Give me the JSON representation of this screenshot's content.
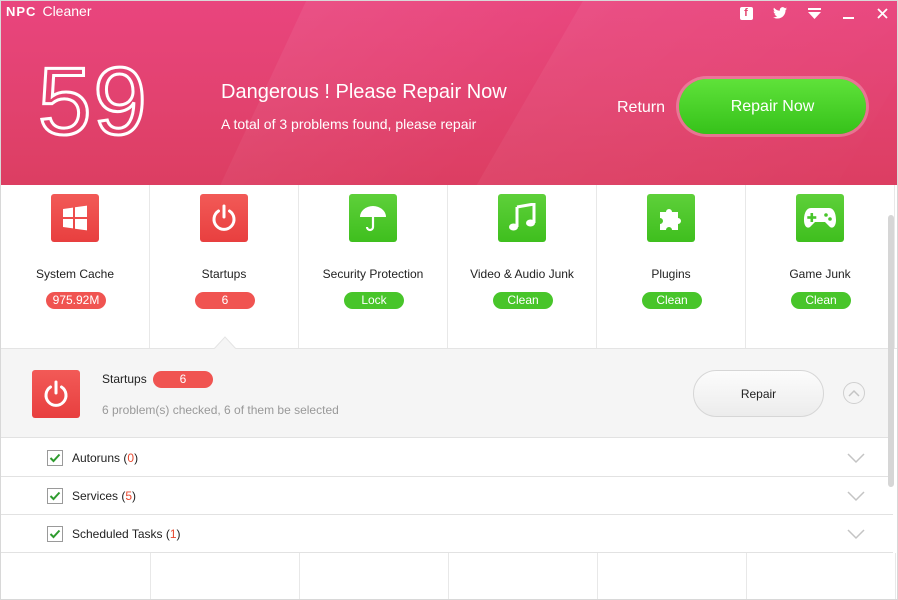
{
  "app": {
    "logo_mark": "NPC",
    "title": "Cleaner"
  },
  "window_controls": [
    {
      "name": "facebook-icon",
      "glyph": "f"
    },
    {
      "name": "twitter-icon",
      "glyph": "🐦"
    },
    {
      "name": "menu-icon",
      "glyph": "▼"
    },
    {
      "name": "minimize-icon",
      "glyph": "—"
    },
    {
      "name": "close-icon",
      "glyph": "✕"
    }
  ],
  "header": {
    "score": "59",
    "status_title": "Dangerous ! Please Repair Now",
    "status_subtitle": "A total of 3 problems found, please repair",
    "return_label": "Return",
    "repair_now_label": "Repair Now"
  },
  "categories": [
    {
      "name": "System Cache",
      "badge": "975.92M",
      "color": "red",
      "icon": "windows-icon"
    },
    {
      "name": "Startups",
      "badge": "6",
      "color": "red",
      "icon": "power-icon"
    },
    {
      "name": "Security Protection",
      "badge": "Lock",
      "color": "green",
      "icon": "umbrella-icon"
    },
    {
      "name": "Video & Audio Junk",
      "badge": "Clean",
      "color": "green",
      "icon": "music-note-icon"
    },
    {
      "name": "Plugins",
      "badge": "Clean",
      "color": "green",
      "icon": "puzzle-icon"
    },
    {
      "name": "Game Junk",
      "badge": "Clean",
      "color": "green",
      "icon": "gamepad-icon"
    }
  ],
  "detail": {
    "title": "Startups",
    "count": "6",
    "description": "6 problem(s) checked, 6 of them be selected",
    "repair_label": "Repair"
  },
  "items": [
    {
      "label": "Autoruns",
      "count": "0",
      "checked": true
    },
    {
      "label": "Services",
      "count": "5",
      "checked": true
    },
    {
      "label": "Scheduled Tasks",
      "count": "1",
      "checked": true
    }
  ],
  "colors": {
    "header": "#e3456f",
    "danger": "#f05451",
    "ok": "#48c52a"
  }
}
